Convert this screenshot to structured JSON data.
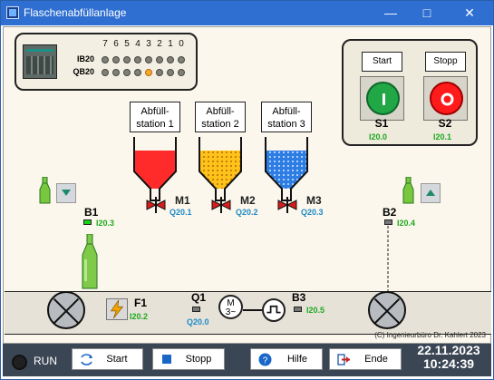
{
  "window": {
    "title": "Flaschenabfüllanlage",
    "minimize": "—",
    "maximize": "□",
    "close": "✕",
    "accent": "#2f6fd1"
  },
  "plc": {
    "bits": [
      "7",
      "6",
      "5",
      "4",
      "3",
      "2",
      "1",
      "0"
    ],
    "registers": [
      "IB20",
      "QB20"
    ],
    "ib20_on": [
      false,
      false,
      false,
      false,
      false,
      false,
      false,
      false
    ],
    "qb20_on": [
      false,
      false,
      false,
      false,
      true,
      false,
      false,
      false
    ]
  },
  "control_panel": {
    "start_label": "Start",
    "stop_label": "Stopp",
    "s1": "S1",
    "s1_addr": "I20.0",
    "s2": "S2",
    "s2_addr": "I20.1"
  },
  "stations": [
    {
      "label_1": "Abfüll-",
      "label_2": "station 1",
      "valve": "M1",
      "valve_addr": "Q20.1",
      "color": "#ff2b2b"
    },
    {
      "label_1": "Abfüll-",
      "label_2": "station 2",
      "valve": "M2",
      "valve_addr": "Q20.2",
      "color": "#ffc21a"
    },
    {
      "label_1": "Abfüll-",
      "label_2": "station 3",
      "valve": "M3",
      "valve_addr": "Q20.3",
      "color": "#2d7de5"
    }
  ],
  "sensors": {
    "b1": "B1",
    "b1_addr": "I20.3",
    "b2": "B2",
    "b2_addr": "I20.4",
    "b3": "B3",
    "b3_addr": "I20.5"
  },
  "drive": {
    "f1": "F1",
    "f1_addr": "I20.2",
    "q1": "Q1",
    "q1_addr": "Q20.0",
    "motor_top": "M",
    "motor_bottom": "3~"
  },
  "credit": "(C) Ingenieurbüro Dr. Kahlert 2023",
  "statusbar": {
    "run": "RUN",
    "start": "Start",
    "stop": "Stopp",
    "help": "Hilfe",
    "end": "Ende",
    "date": "22.11.2023",
    "time": "10:24:39"
  }
}
